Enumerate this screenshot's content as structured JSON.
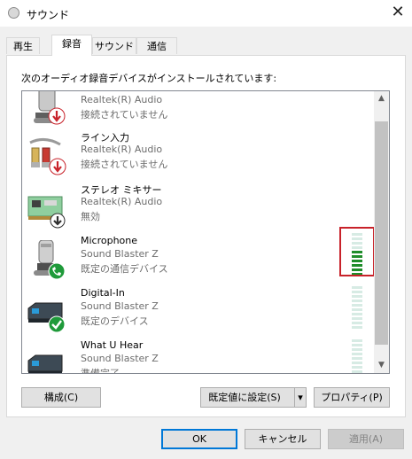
{
  "window": {
    "title": "サウンド",
    "close_glyph": "✕"
  },
  "tabs": [
    "再生",
    "録音",
    "サウンド",
    "通信"
  ],
  "active_tab": 1,
  "panel": {
    "label": "次のオーディオ録音デバイスがインストールされています:"
  },
  "devices": [
    {
      "name": "",
      "line2": "Realtek(R) Audio",
      "line3": "接続されていません",
      "icon": "microphone-icon",
      "status_icon": "disconnected-arrow-icon"
    },
    {
      "name": "ライン入力",
      "line2": "Realtek(R) Audio",
      "line3": "接続されていません",
      "icon": "rca-cable-icon",
      "status_icon": "disconnected-arrow-icon"
    },
    {
      "name": "ステレオ ミキサー",
      "line2": "Realtek(R) Audio",
      "line3": "無効",
      "icon": "sound-card-icon",
      "status_icon": "disabled-arrow-icon"
    },
    {
      "name": "Microphone",
      "line2": "Sound Blaster Z",
      "line3": "既定の通信デバイス",
      "icon": "microphone-icon",
      "status_icon": "phone-icon"
    },
    {
      "name": "Digital-In",
      "line2": "Sound Blaster Z",
      "line3": "既定のデバイス",
      "icon": "audio-device-icon",
      "status_icon": "check-icon"
    },
    {
      "name": "What U Hear",
      "line2": "Sound Blaster Z",
      "line3": "準備完了",
      "icon": "audio-device-icon",
      "status_icon": ""
    }
  ],
  "meters": {
    "microphone_active_segments": 6,
    "total_segments": 10,
    "active_color": "#1f8d2a",
    "idle_color": "#d7ebe4"
  },
  "buttons": {
    "configure": "構成(C)",
    "set_default": "既定値に設定(S)",
    "properties": "プロパティ(P)",
    "ok": "OK",
    "cancel": "キャンセル",
    "apply": "適用(A)"
  },
  "highlight_color": "#c8222a"
}
